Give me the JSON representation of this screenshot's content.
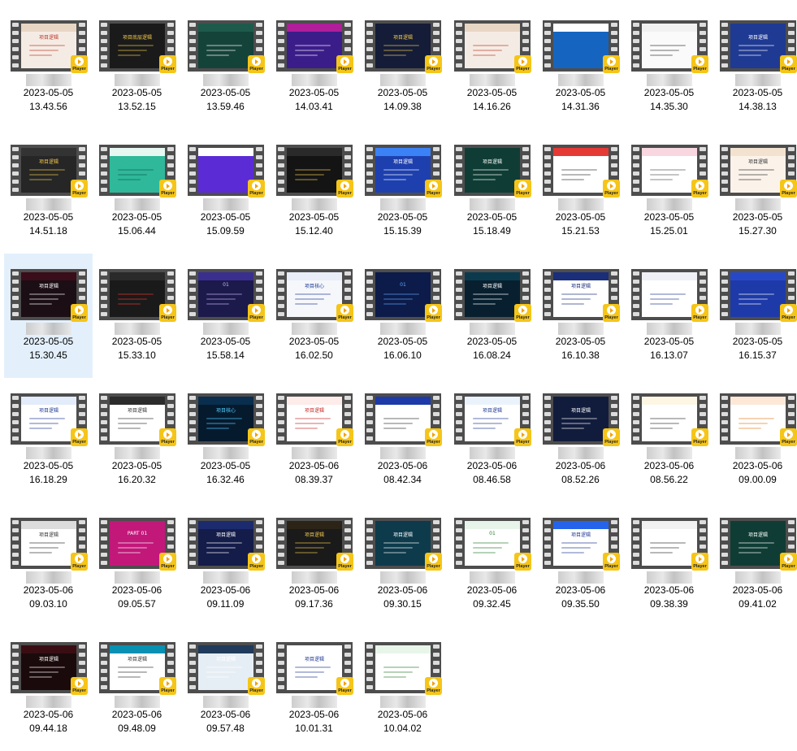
{
  "player_badge_text": "Player",
  "items": [
    {
      "prefix": "",
      "suffix": "",
      "date": "2023-05-05",
      "time": "13.43.56",
      "bg": "#f4ece4",
      "band": "#e8d6c4",
      "fg": "#c0392b",
      "title": "项目逻辑"
    },
    {
      "prefix": "",
      "suffix": "",
      "date": "2023-05-05",
      "time": "13.52.15",
      "bg": "#1a1a1a",
      "band": "#1a1a1a",
      "fg": "#f2c94c",
      "title": "项目底层逻辑"
    },
    {
      "prefix": "",
      "suffix": "",
      "date": "2023-05-05",
      "time": "13.59.46",
      "bg": "#14433a",
      "band": "#1e5a4c",
      "fg": "#ffffff",
      "title": ""
    },
    {
      "prefix": "",
      "suffix": "",
      "date": "2023-05-05",
      "time": "14.03.41",
      "bg": "#3b1d8a",
      "band": "#b01e9a",
      "fg": "#ffffff",
      "title": ""
    },
    {
      "prefix": "",
      "suffix": "",
      "date": "2023-05-05",
      "time": "14.09.38",
      "bg": "#141c38",
      "band": "#141c38",
      "fg": "#f2c94c",
      "title": "项目逻辑"
    },
    {
      "prefix": "",
      "suffix": "",
      "date": "2023-05-05",
      "time": "14.16.26",
      "bg": "#f4ece4",
      "band": "#e8d6c4",
      "fg": "#c0392b",
      "title": ""
    },
    {
      "prefix": "",
      "suffix": "",
      "date": "2023-05-05",
      "time": "14.31.36",
      "bg": "#1565c0",
      "band": "#ffffff",
      "fg": "#1565c0",
      "title": "项目逻辑"
    },
    {
      "prefix": "",
      "suffix": "",
      "date": "2023-05-05",
      "time": "14.35.30",
      "bg": "#fafafa",
      "band": "#f1f1f1",
      "fg": "#333333",
      "title": ""
    },
    {
      "prefix": "",
      "suffix": "",
      "date": "2023-05-05",
      "time": "14.38.13",
      "bg": "#1f3a93",
      "band": "#1f3a93",
      "fg": "#ffffff",
      "title": "项目逻辑"
    },
    {
      "prefix": "",
      "suffix": "",
      "date": "2023-05-05",
      "time": "14.51.18",
      "bg": "#262626",
      "band": "#333333",
      "fg": "#f2c94c",
      "title": "项目逻辑"
    },
    {
      "prefix": "",
      "suffix": "",
      "date": "2023-05-05",
      "time": "15.06.44",
      "bg": "#2fb89a",
      "band": "#e6f7f2",
      "fg": "#0f5e4f",
      "title": ""
    },
    {
      "prefix": "",
      "suffix": "",
      "date": "2023-05-05",
      "time": "15.09.59",
      "bg": "#5b2bd6",
      "band": "#ffffff",
      "fg": "#5b2bd6",
      "title": ""
    },
    {
      "prefix": "",
      "suffix": "",
      "date": "2023-05-05",
      "time": "15.12.40",
      "bg": "#141414",
      "band": "#2a2a2a",
      "fg": "#f2c94c",
      "title": ""
    },
    {
      "prefix": "",
      "suffix": "",
      "date": "2023-05-05",
      "time": "15.15.39",
      "bg": "#1e40af",
      "band": "#3b82f6",
      "fg": "#ffffff",
      "title": "项目逻辑"
    },
    {
      "prefix": "",
      "suffix": "",
      "date": "2023-05-05",
      "time": "15.18.49",
      "bg": "#0f3d35",
      "band": "#0f3d35",
      "fg": "#ffffff",
      "title": "项目逻辑"
    },
    {
      "prefix": "",
      "suffix": "",
      "date": "2023-05-05",
      "time": "15.21.53",
      "bg": "#ffffff",
      "band": "#e53935",
      "fg": "#333333",
      "title": ""
    },
    {
      "prefix": "",
      "suffix": "",
      "date": "2023-05-05",
      "time": "15.25.01",
      "bg": "#ffffff",
      "band": "#f8d7e0",
      "fg": "#555555",
      "title": ""
    },
    {
      "prefix": "",
      "suffix": "",
      "date": "2023-05-05",
      "time": "15.27.30",
      "bg": "#fbf3ea",
      "band": "#f3e2cf",
      "fg": "#333333",
      "title": "项目逻辑"
    },
    {
      "prefix": "",
      "suffix": "",
      "date": "2023-05-05",
      "time": "15.30.45",
      "bg": "#1b0e14",
      "band": "#3a0d1a",
      "fg": "#ffffff",
      "title": "项目逻辑"
    },
    {
      "prefix": "",
      "suffix": "",
      "date": "2023-05-05",
      "time": "15.33.10",
      "bg": "#1a1a1a",
      "band": "#2a2a2a",
      "fg": "#e53935",
      "title": ""
    },
    {
      "prefix": "",
      "suffix": "",
      "date": "2023-05-05",
      "time": "15.58.14",
      "bg": "#1c1a4a",
      "band": "#3a2f8f",
      "fg": "#c4b5fd",
      "title": "01"
    },
    {
      "prefix": "",
      "suffix": "",
      "date": "2023-05-05",
      "time": "16.02.50",
      "bg": "#f5f7fb",
      "band": "#e8edf7",
      "fg": "#1f3a93",
      "title": "项目核心"
    },
    {
      "prefix": "",
      "suffix": "",
      "date": "2023-05-05",
      "time": "16.06.10",
      "bg": "#0c1b4a",
      "band": "#0c1b4a",
      "fg": "#60a5fa",
      "title": "01"
    },
    {
      "prefix": "",
      "suffix": "",
      "date": "2023-05-05",
      "time": "16.08.24",
      "bg": "#071f2e",
      "band": "#0b3a4d",
      "fg": "#ffffff",
      "title": "项目逻辑"
    },
    {
      "prefix": "",
      "suffix": "",
      "date": "2023-05-05",
      "time": "16.10.38",
      "bg": "#ffffff",
      "band": "#1a2e7a",
      "fg": "#1a2e7a",
      "title": "项目逻辑"
    },
    {
      "prefix": "",
      "suffix": "",
      "date": "2023-05-05",
      "time": "16.13.07",
      "bg": "#ffffff",
      "band": "#eef0f5",
      "fg": "#1f3a93",
      "title": ""
    },
    {
      "prefix": "",
      "suffix": "",
      "date": "2023-05-05",
      "time": "16.15.37",
      "bg": "#1e3aa8",
      "band": "#2748c6",
      "fg": "#ffffff",
      "title": ""
    },
    {
      "prefix": "",
      "suffix": "",
      "date": "2023-05-05",
      "time": "16.18.29",
      "bg": "#ffffff",
      "band": "#e3ecfb",
      "fg": "#1f3a93",
      "title": "项目逻辑"
    },
    {
      "prefix": "",
      "suffix": "",
      "date": "2023-05-05",
      "time": "16.20.32",
      "bg": "#ffffff",
      "band": "#2b2b2b",
      "fg": "#333333",
      "title": "项目逻辑"
    },
    {
      "prefix": "",
      "suffix": "",
      "date": "2023-05-05",
      "time": "16.32.46",
      "bg": "#061a2e",
      "band": "#0a2e4d",
      "fg": "#4fd1ff",
      "title": "项目核心"
    },
    {
      "prefix": "",
      "suffix": "",
      "date": "2023-05-06",
      "time": "08.39.37",
      "bg": "#ffffff",
      "band": "#fdecea",
      "fg": "#c62828",
      "title": "项目逻辑"
    },
    {
      "prefix": "",
      "suffix": "",
      "date": "2023-05-06",
      "time": "08.42.34",
      "bg": "#ffffff",
      "band": "#1e3aa8",
      "fg": "#333333",
      "title": ""
    },
    {
      "prefix": "",
      "suffix": "",
      "date": "2023-05-06",
      "time": "08.46.58",
      "bg": "#ffffff",
      "band": "#eaf3fb",
      "fg": "#1f3a93",
      "title": "项目逻辑"
    },
    {
      "prefix": "",
      "suffix": "",
      "date": "2023-05-06",
      "time": "08.52.26",
      "bg": "#111c3d",
      "band": "#111c3d",
      "fg": "#ffffff",
      "title": "项目逻辑"
    },
    {
      "prefix": "",
      "suffix": "",
      "date": "2023-05-06",
      "time": "08.56.22",
      "bg": "#ffffff",
      "band": "#fdf6e3",
      "fg": "#333333",
      "title": ""
    },
    {
      "prefix": "",
      "suffix": "",
      "date": "2023-05-06",
      "time": "09.00.09",
      "bg": "#ffffff",
      "band": "#fde8d8",
      "fg": "#e67e22",
      "title": ""
    },
    {
      "prefix": "",
      "suffix": "",
      "date": "2023-05-06",
      "time": "09.03.10",
      "bg": "#ffffff",
      "band": "#dcdcdc",
      "fg": "#333333",
      "title": "项目逻辑"
    },
    {
      "prefix": "",
      "suffix": "",
      "date": "2023-05-06",
      "time": "09.05.57",
      "bg": "#c2187a",
      "band": "#c2187a",
      "fg": "#ffffff",
      "title": "PART 01"
    },
    {
      "prefix": "",
      "suffix": "",
      "date": "2023-05-06",
      "time": "09.11.09",
      "bg": "#141c4a",
      "band": "#1c2b6e",
      "fg": "#ffffff",
      "title": "项目逻辑"
    },
    {
      "prefix": "",
      "suffix": "",
      "date": "2023-05-06",
      "time": "09.17.36",
      "bg": "#1a1a1a",
      "band": "#2c2416",
      "fg": "#f2c94c",
      "title": "项目逻辑"
    },
    {
      "prefix": "",
      "suffix": "",
      "date": "2023-05-06",
      "time": "09.30.15",
      "bg": "#0d3b4c",
      "band": "#0d3b4c",
      "fg": "#ffffff",
      "title": "项目逻辑"
    },
    {
      "prefix": "",
      "suffix": "",
      "date": "2023-05-06",
      "time": "09.32.45",
      "bg": "#ffffff",
      "band": "#e6f4ea",
      "fg": "#2e7d32",
      "title": "01"
    },
    {
      "prefix": "",
      "suffix": "",
      "date": "2023-05-06",
      "time": "09.35.50",
      "bg": "#ffffff",
      "band": "#2563eb",
      "fg": "#1f3a93",
      "title": "项目逻辑"
    },
    {
      "prefix": "",
      "suffix": "",
      "date": "2023-05-06",
      "time": "09.38.39",
      "bg": "#ffffff",
      "band": "#f1f1f1",
      "fg": "#333333",
      "title": ""
    },
    {
      "prefix": "",
      "suffix": "",
      "date": "2023-05-06",
      "time": "09.41.02",
      "bg": "#0f3d35",
      "band": "#0f3d35",
      "fg": "#ffffff",
      "title": "项目逻辑"
    },
    {
      "prefix": "",
      "suffix": "",
      "date": "2023-05-06",
      "time": "09.44.18",
      "bg": "#1b0a0c",
      "band": "#3a0d12",
      "fg": "#ffffff",
      "title": "项目逻辑"
    },
    {
      "prefix": "",
      "suffix": "",
      "date": "2023-05-06",
      "time": "09.48.09",
      "bg": "#ffffff",
      "band": "#0891b2",
      "fg": "#333333",
      "title": "项目逻辑"
    },
    {
      "prefix": "",
      "suffix": "",
      "date": "2023-05-06",
      "time": "09.57.48",
      "bg": "#e6eef5",
      "band": "#1f3a5a",
      "fg": "#ffffff",
      "title": "项目逻辑"
    },
    {
      "prefix": "",
      "suffix": "",
      "date": "2023-05-06",
      "time": "10.01.31",
      "bg": "#ffffff",
      "band": "#ffffff",
      "fg": "#1f3a93",
      "title": "项目逻辑"
    },
    {
      "prefix": "",
      "suffix": "",
      "date": "2023-05-06",
      "time": "10.04.02",
      "bg": "#ffffff",
      "band": "#e8f5e9",
      "fg": "#2e7d32",
      "title": ""
    }
  ],
  "selected_index": 18
}
